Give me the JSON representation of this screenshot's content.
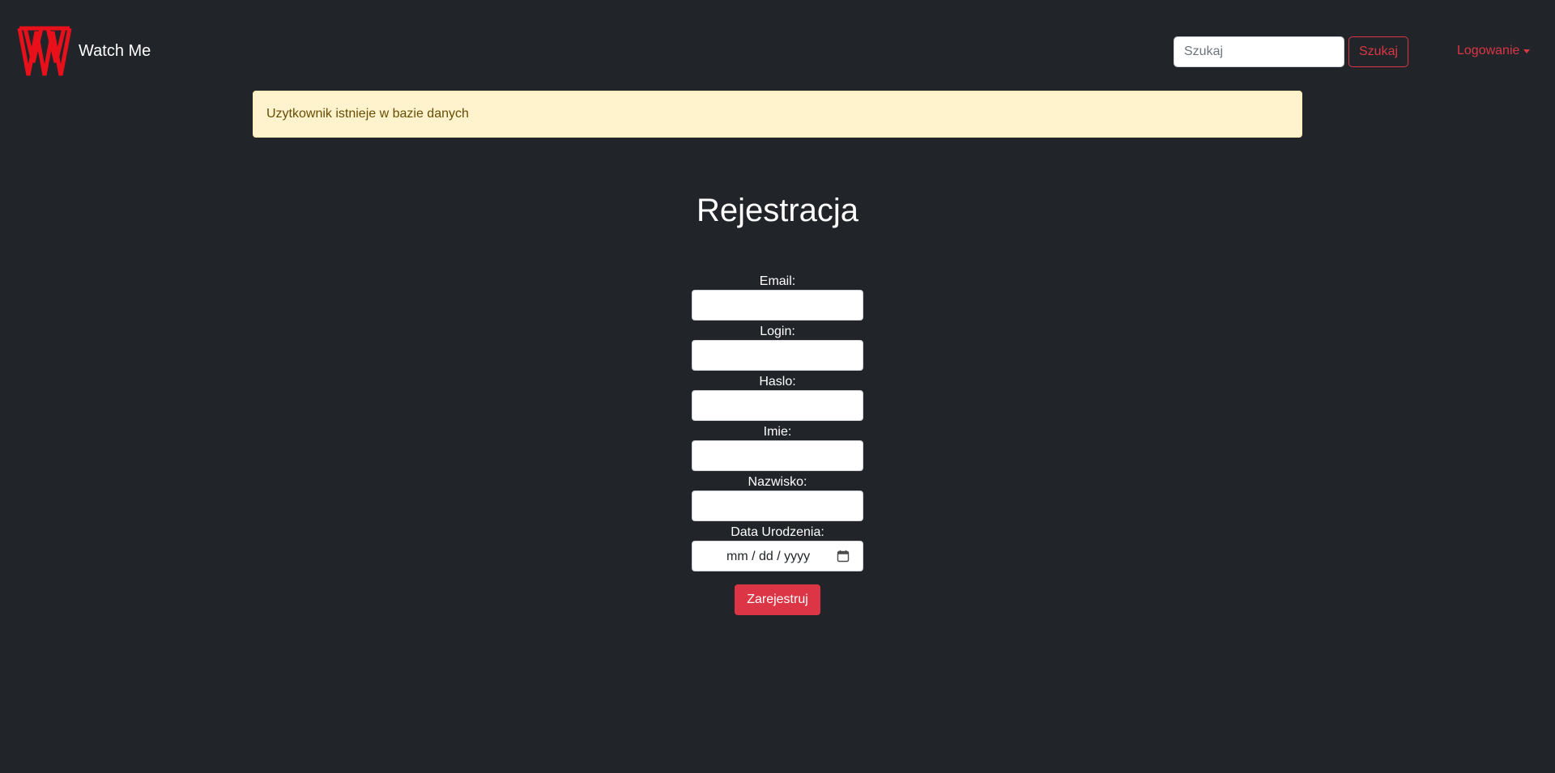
{
  "brand": {
    "name": "Watch Me",
    "logo_icon": "watchme-w-logo-icon",
    "logo_color": "#e8101a"
  },
  "search": {
    "placeholder": "Szukaj",
    "value": "",
    "button_label": "Szukaj"
  },
  "nav": {
    "login_label": "Logowanie",
    "login_icon": "caret-down-icon"
  },
  "alert": {
    "message": "Uzytkownik istnieje w bazie danych",
    "type": "warning"
  },
  "page": {
    "title": "Rejestracja"
  },
  "form": {
    "fields": [
      {
        "label": "Email:",
        "value": ""
      },
      {
        "label": "Login:",
        "value": ""
      },
      {
        "label": "Haslo:",
        "value": ""
      },
      {
        "label": "Imie:",
        "value": ""
      },
      {
        "label": "Nazwisko:",
        "value": ""
      }
    ],
    "birthdate": {
      "label": "Data Urodzenia:",
      "placeholder": "mm / dd / yyyy",
      "icon": "calendar-icon"
    },
    "submit_label": "Zarejestruj"
  },
  "colors": {
    "background": "#212529",
    "accent": "#dc3545",
    "alert_bg": "#fff3cd",
    "alert_text": "#664d03"
  }
}
